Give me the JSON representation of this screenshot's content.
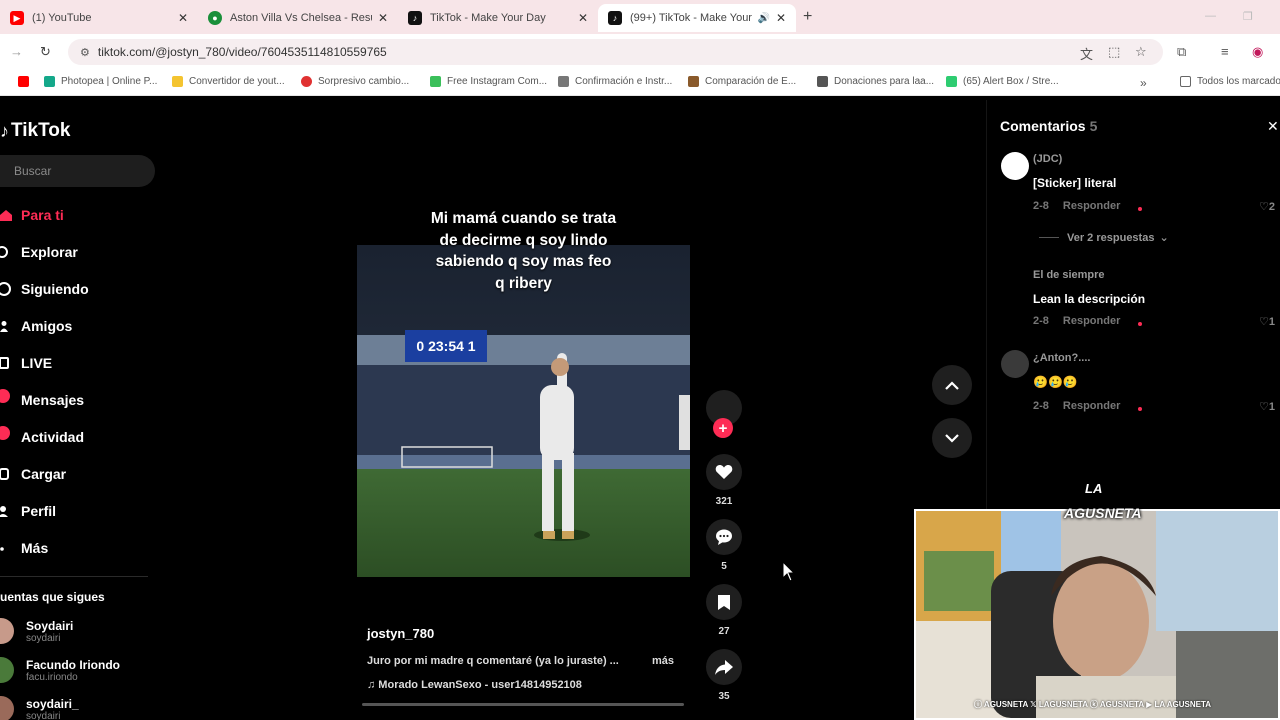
{
  "browser": {
    "tabs": [
      {
        "title": "(1) YouTube",
        "favicon": "youtube-icon",
        "color": "#ff0000",
        "active": false
      },
      {
        "title": "Aston Villa Vs Chelsea - Resulta",
        "favicon": "football-icon",
        "color": "#1a8f3a",
        "active": false
      },
      {
        "title": "TikTok - Make Your Day",
        "favicon": "tiktok-icon",
        "color": "#111111",
        "active": false
      },
      {
        "title": "(99+) TikTok - Make Your Da",
        "favicon": "tiktok-icon",
        "color": "#111111",
        "active": true
      }
    ],
    "url": "tiktok.com/@jostyn_780/video/7604535114810559765",
    "bookmarks": [
      {
        "label": "Photopea | Online P...",
        "color": "#14a88a"
      },
      {
        "label": "Convertidor de yout...",
        "color": "#f4c430"
      },
      {
        "label": "Sorpresivo cambio...",
        "color": "#e03131"
      },
      {
        "label": "Free Instagram Com...",
        "color": "#3bbf5a"
      },
      {
        "label": "Confirmación e Instr...",
        "color": "#777777"
      },
      {
        "label": "Comparación de E...",
        "color": "#8a5a2b"
      },
      {
        "label": "Donaciones para laa...",
        "color": "#555555"
      },
      {
        "label": "(65) Alert Box / Stre...",
        "color": "#2ecc71"
      }
    ],
    "bookmarks_all": "Todos los marcado"
  },
  "tiktok": {
    "logo": "TikTok",
    "search_placeholder": "Buscar",
    "nav": [
      {
        "label": "Para ti",
        "icon": "home-icon",
        "active": true
      },
      {
        "label": "Explorar",
        "icon": "compass-icon"
      },
      {
        "label": "Siguiendo",
        "icon": "following-icon"
      },
      {
        "label": "Amigos",
        "icon": "friends-icon"
      },
      {
        "label": "LIVE",
        "icon": "live-icon"
      },
      {
        "label": "Mensajes",
        "icon": "messages-icon",
        "badge": true
      },
      {
        "label": "Actividad",
        "icon": "activity-icon",
        "badge": true
      },
      {
        "label": "Cargar",
        "icon": "upload-icon"
      },
      {
        "label": "Perfil",
        "icon": "profile-icon"
      },
      {
        "label": "Más",
        "icon": "more-icon"
      }
    ],
    "following_title": "uentas que sigues",
    "following": [
      {
        "name": "Soydairi",
        "handle": "soydairi",
        "color": "#c79a8a"
      },
      {
        "name": "Facundo Iriondo",
        "handle": "facu.iriondo",
        "color": "#4a7a3a"
      },
      {
        "name": "soydairi_",
        "handle": "soydairi",
        "color": "#9a6a5a"
      }
    ],
    "video": {
      "overlay_lines": [
        "Mi mamá cuando se trata",
        "de decirme q soy lindo",
        "sabiendo q soy mas feo",
        "q ribery"
      ],
      "scoreboard": "0 23:54 1",
      "author": "jostyn_780",
      "caption": "Juro por mi madre q comentaré (ya lo juraste) ...",
      "more": "más",
      "music": "♫  Morado LewanSexo - user14814952108"
    },
    "actions": {
      "likes": "321",
      "comments": "5",
      "saves": "27",
      "shares": "35"
    },
    "comments_panel": {
      "title": "Comentarios",
      "count": "5",
      "items": [
        {
          "user": "(JDC)",
          "text": "[Sticker] literal",
          "date": "2-8",
          "reply": "Responder",
          "likes": "2"
        },
        {
          "user": "El de siempre",
          "text": "Lean la descripción",
          "date": "2-8",
          "reply": "Responder",
          "likes": "1"
        },
        {
          "user": "¿Anton?....",
          "text": "🥲🥲🥲",
          "date": "2-8",
          "reply": "Responder",
          "likes": "1"
        }
      ],
      "view_replies": "Ver 2 respuestas"
    }
  },
  "stream_overlay": {
    "logo_top": "LA",
    "logo_main": "AGUSNETA",
    "socials": "ⓘ AGUSNETA  𝕏 LAGUSNETA  ⓚ AGUSNETA  ▶ LA AGUSNETA"
  }
}
